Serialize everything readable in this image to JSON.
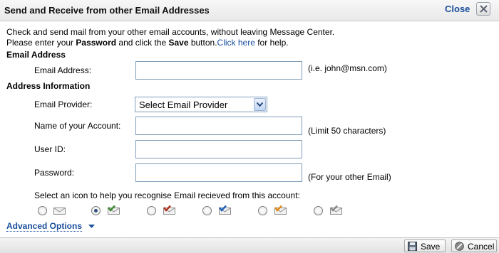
{
  "dialog": {
    "title": "Send and Receive from other Email Addresses",
    "close_label": "Close"
  },
  "intro": {
    "line1": "Check and send mail from your other email accounts, without leaving Message Center.",
    "line2_a": "Please enter your ",
    "line2_password": "Password",
    "line2_b": " and click the ",
    "line2_save": "Save",
    "line2_c": " button.",
    "help_link": "Click here",
    "line2_d": " for help."
  },
  "email_section": {
    "heading": "Email Address",
    "email_label": "Email Address:",
    "email_value": "",
    "email_hint": "(i.e. john@msn.com)"
  },
  "address_section": {
    "heading": "Address Information",
    "provider_label": "Email Provider:",
    "provider_selected": "Select Email Provider",
    "account_label": "Name of your Account:",
    "account_value": "",
    "account_hint": "(Limit 50 characters)",
    "userid_label": "User ID:",
    "userid_value": "",
    "password_label": "Password:",
    "password_value": "",
    "password_hint": "(For your other Email)"
  },
  "icons": {
    "prompt": "Select an icon to help you recognise Email recieved from this account:",
    "selected_index": 1,
    "options": [
      {
        "icon": "envelope-plain-icon",
        "mark_color": ""
      },
      {
        "icon": "envelope-green-check-icon",
        "mark_color": "#3a8a2e"
      },
      {
        "icon": "envelope-red-check-icon",
        "mark_color": "#b0301c"
      },
      {
        "icon": "envelope-blue-check-icon",
        "mark_color": "#1f5fb8"
      },
      {
        "icon": "envelope-orange-check-icon",
        "mark_color": "#e08a12"
      },
      {
        "icon": "envelope-gray-check-icon",
        "mark_color": "#8a8a8a"
      }
    ]
  },
  "advanced": {
    "label": "Advanced Options"
  },
  "footer": {
    "save_label": "Save",
    "cancel_label": "Cancel"
  },
  "colors": {
    "link": "#1a4f9c",
    "input_border": "#7f9db9"
  }
}
